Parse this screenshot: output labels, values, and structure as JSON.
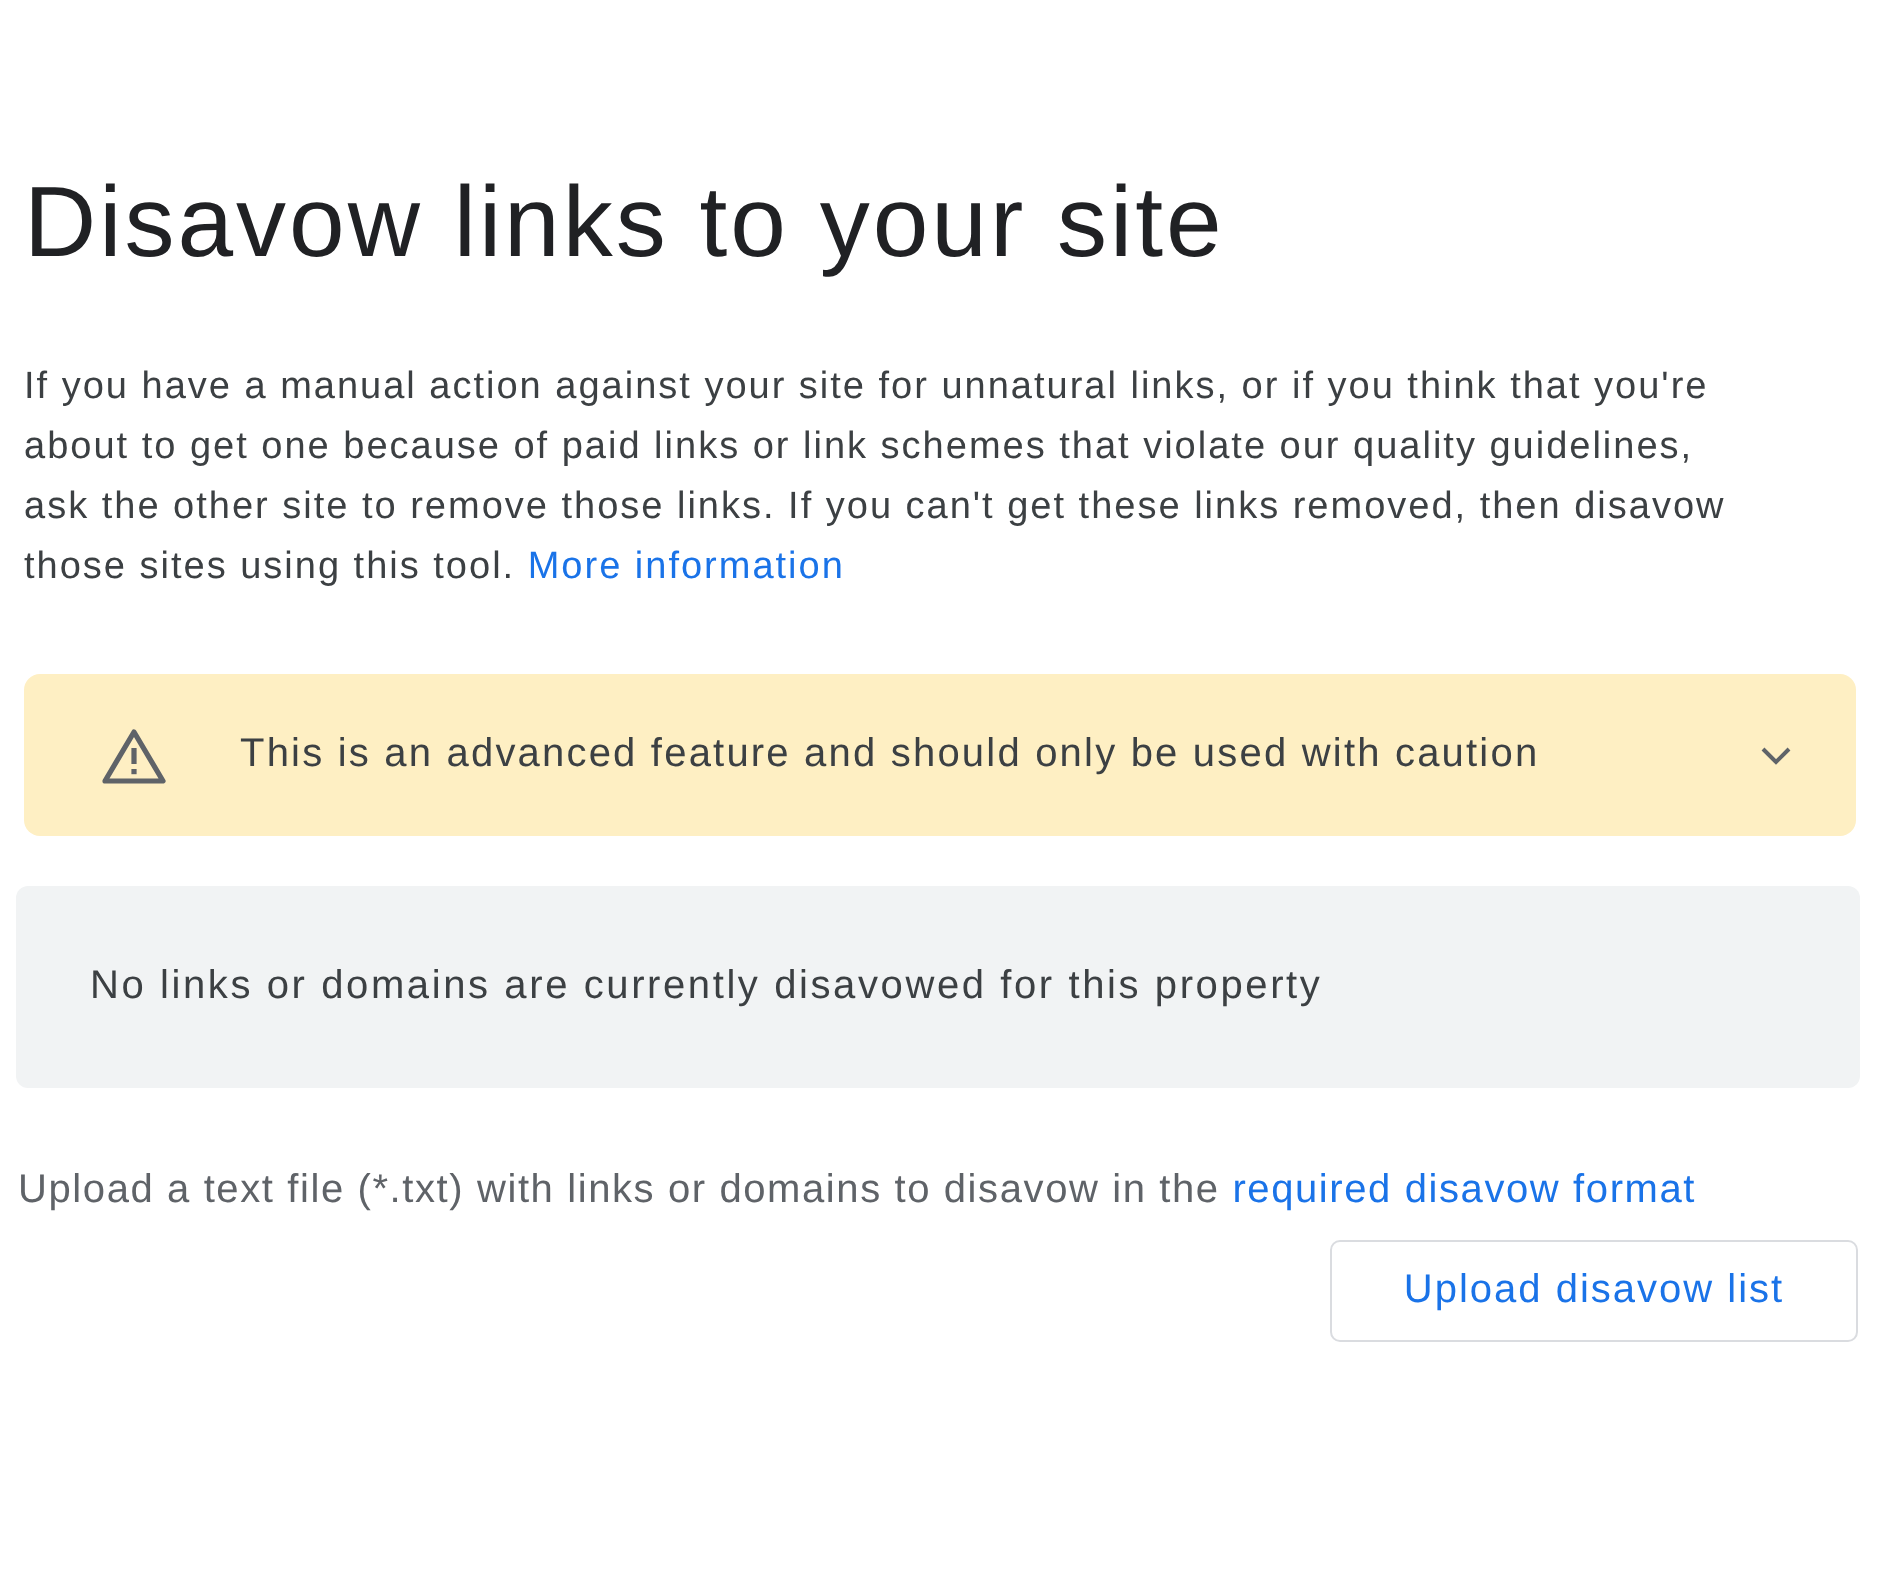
{
  "page": {
    "title": "Disavow links to your site"
  },
  "intro": {
    "text": "If you have a manual action against your site for unnatural links, or if you think that you're about to get one because of paid links or link schemes that violate our quality guidelines, ask the other site to remove those links. If you can't get these links removed, then disavow those sites using this tool.",
    "link": "More information"
  },
  "warning": {
    "text": "This is an advanced feature and should only be used with caution",
    "expanded": false
  },
  "status": {
    "text": "No links or domains are currently disavowed for this property"
  },
  "upload": {
    "text": "Upload a text file (*.txt) with links or domains to disavow in the",
    "link": "required disavow format",
    "button": "Upload disavow list"
  }
}
